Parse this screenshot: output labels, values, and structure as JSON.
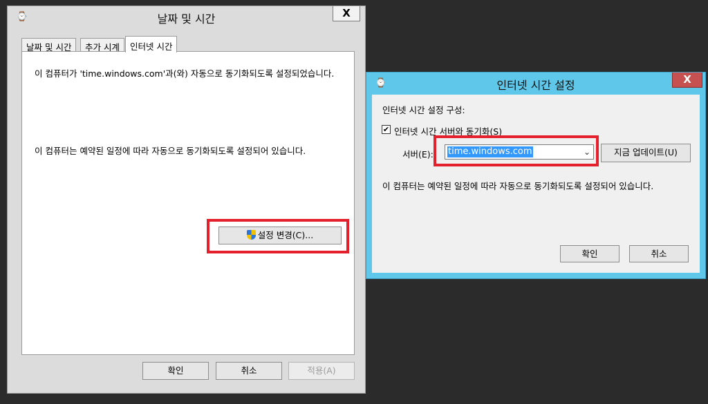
{
  "main_window": {
    "title": "날짜 및 시간",
    "close_label": "X",
    "tabs": [
      {
        "label": "날짜 및 시간"
      },
      {
        "label": "추가 시계"
      },
      {
        "label": "인터넷 시간"
      }
    ],
    "status_text": "이 컴퓨터가 'time.windows.com'과(와) 자동으로 동기화되도록 설정되었습니다.",
    "schedule_text": "이 컴퓨터는 예약된 일정에 따라 자동으로 동기화되도록 설정되어 있습니다.",
    "change_settings_label": "설정 변경(C)...",
    "ok_label": "확인",
    "cancel_label": "취소",
    "apply_label": "적용(A)"
  },
  "internet_time_dialog": {
    "title": "인터넷 시간 설정",
    "close_label": "X",
    "section_label": "인터넷 시간 설정 구성:",
    "sync_checkbox_label": "인터넷 시간 서버와 동기화(S)",
    "sync_checked": true,
    "server_label": "서버(E):",
    "server_value": "time.windows.com",
    "update_now_label": "지금 업데이트(U)",
    "schedule_text": "이 컴퓨터는 예약된 일정에 따라 자동으로 동기화되도록 설정되어 있습니다.",
    "ok_label": "확인",
    "cancel_label": "취소"
  },
  "colors": {
    "highlight": "#e3202c",
    "dialog_frame": "#5ec7ea",
    "selection": "#3399ff"
  }
}
